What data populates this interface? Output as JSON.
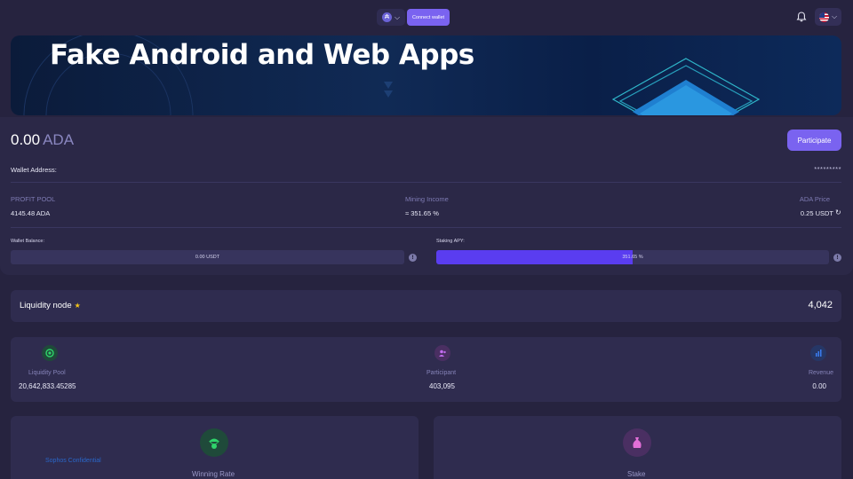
{
  "header": {
    "chain_icon": "cardano-coin-icon",
    "connect_label": "Connect wallet",
    "notification_icon": "bell-icon",
    "language_icon": "us-flag-icon"
  },
  "banner": {
    "title": "Fake Android and Web Apps"
  },
  "wallet": {
    "balance_amount": "0.00",
    "balance_unit": "ADA",
    "participate_label": "Participate",
    "address_label": "Wallet Address:",
    "address_value": "*********"
  },
  "stats": {
    "profit_pool_label": "PROFIT POOL",
    "profit_pool_value": "4145.48 ADA",
    "mining_income_label": "Mining Income",
    "mining_income_value": "≈ 351.65 %",
    "ada_price_label": "ADA Price",
    "ada_price_value": "0.25 USDT",
    "refresh_icon": "refresh-icon"
  },
  "bars": {
    "wallet_balance_label": "Wallet Balance:",
    "wallet_balance_value": "0.00 USDT",
    "wallet_balance_fill": 0,
    "staking_apy_label": "Staking APY:",
    "staking_apy_value": "351.65 %",
    "staking_apy_fill": 0.5
  },
  "node": {
    "label": "Liquidity node",
    "value": "4,042"
  },
  "pool_stats": [
    {
      "label": "Liquidity Pool",
      "value": "20,642,833.45285",
      "icon": "liquidity-pool-icon",
      "color": "#2fd36b"
    },
    {
      "label": "Participant",
      "value": "403,095",
      "icon": "participants-icon",
      "color": "#c36df0"
    },
    {
      "label": "Revenue",
      "value": "0.00",
      "icon": "bar-chart-icon",
      "color": "#3a7cf0"
    }
  ],
  "bottom_cards": {
    "winning_rate_label": "Winning Rate",
    "winning_rate_icon": "money-bag-parachute-icon",
    "stake_label": "Stake",
    "stake_icon": "money-bag-icon"
  },
  "watermark": "Sophos Confidential",
  "colors": {
    "accent": "#7a63f0",
    "background": "#26233f",
    "card": "#2f2c4f",
    "bar_fill": "#5a3df0"
  }
}
